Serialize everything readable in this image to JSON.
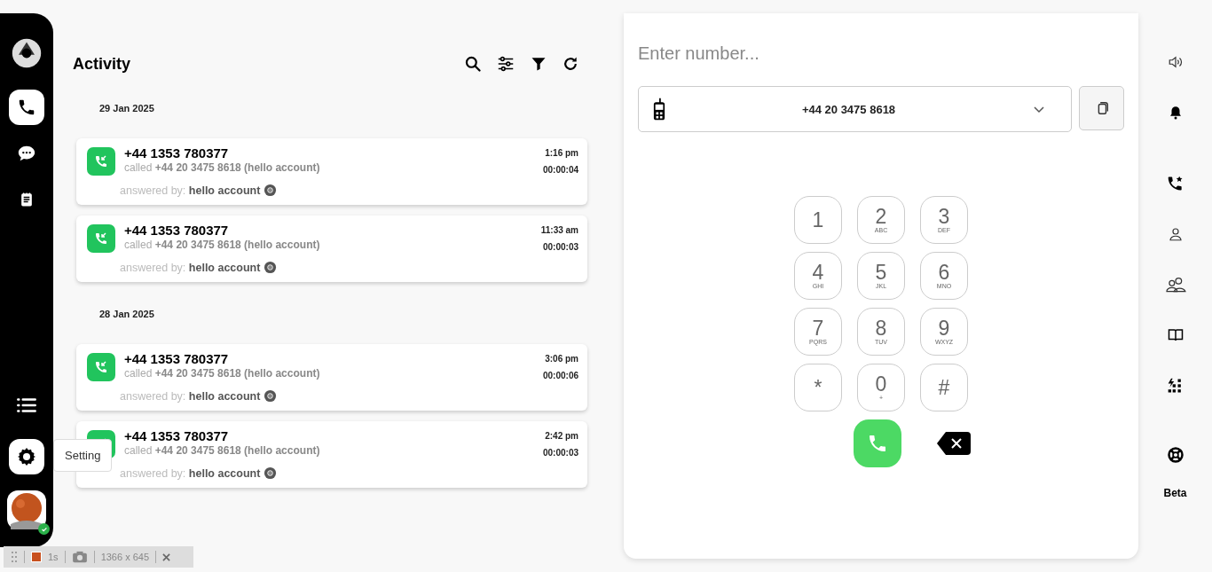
{
  "sidebar": {
    "nav": [
      {
        "kind": "phone",
        "selected": true
      },
      {
        "kind": "chat",
        "selected": false
      },
      {
        "kind": "notes",
        "selected": false
      }
    ],
    "bottom": [
      {
        "kind": "menu",
        "selected": false
      },
      {
        "kind": "settings",
        "selected": true,
        "tooltip": "Setting"
      }
    ],
    "avatar": {
      "online": true
    }
  },
  "activity": {
    "title": "Activity",
    "groups": [
      {
        "date": "29 Jan 2025",
        "calls": [
          {
            "number": "+44 1353 780377",
            "detail": "called **+44 20 3475 8618 (hello account)**",
            "answered": "answered by: **hello account**",
            "time": "1:16 pm",
            "duration": "00:00:04"
          },
          {
            "number": "+44 1353 780377",
            "detail": "called **+44 20 3475 8618 (hello account)**",
            "answered": "answered by: **hello account**",
            "time": "11:33 am",
            "duration": "00:00:03"
          }
        ]
      },
      {
        "date": "28 Jan 2025",
        "calls": [
          {
            "number": "+44 1353 780377",
            "detail": "called **+44 20 3475 8618 (hello account)**",
            "answered": "answered by: **hello account**",
            "time": "3:06 pm",
            "duration": "00:00:06"
          },
          {
            "number": "+44 1353 780377",
            "detail": "called **+44 20 3475 8618 (hello account)**",
            "answered": "answered by: **hello account**",
            "time": "2:42 pm",
            "duration": "00:00:03"
          }
        ]
      }
    ]
  },
  "dialer": {
    "placeholder": "Enter number...",
    "line": "+44 20 3475 8618",
    "keys": [
      {
        "digit": "1"
      },
      {
        "digit": "2",
        "letters": "ABC"
      },
      {
        "digit": "3",
        "letters": "DEF"
      },
      {
        "digit": "4",
        "letters": "GHI"
      },
      {
        "digit": "5",
        "letters": "JKL"
      },
      {
        "digit": "6",
        "letters": "MNO"
      },
      {
        "digit": "7",
        "letters": "PQRS"
      },
      {
        "digit": "8",
        "letters": "TUV"
      },
      {
        "digit": "9",
        "letters": "WXYZ"
      },
      {
        "digit": "*"
      },
      {
        "digit": "0",
        "letters": "+"
      },
      {
        "digit": "#"
      }
    ]
  },
  "right_rail": {
    "items": [
      {
        "kind": "speaker"
      },
      {
        "kind": "bell"
      },
      {
        "kind": "star-call"
      },
      {
        "kind": "person"
      },
      {
        "kind": "people"
      },
      {
        "kind": "book"
      },
      {
        "kind": "grid"
      },
      {
        "kind": "lifebuoy"
      }
    ],
    "label": "Beta"
  },
  "recorder": {
    "frame_time": "1s",
    "size": "1366 x 645"
  }
}
